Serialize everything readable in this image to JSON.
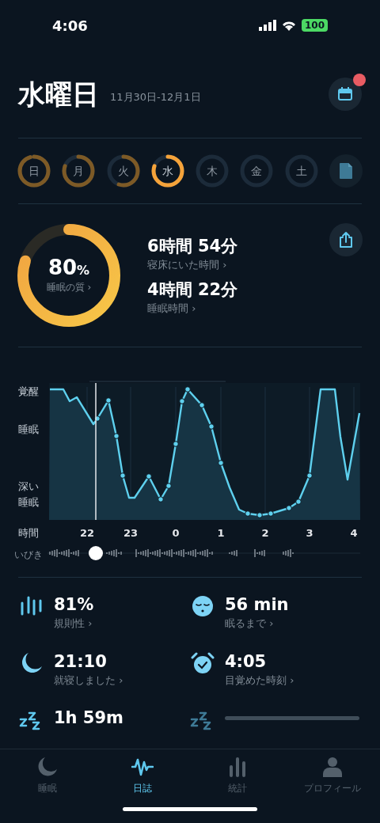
{
  "status_bar": {
    "time": "4:06",
    "battery": "100"
  },
  "header": {
    "title": "水曜日",
    "date_range": "11月30日-12月1日",
    "calendar_badge": true
  },
  "days": [
    {
      "label": "日",
      "selected": false
    },
    {
      "label": "月",
      "selected": false
    },
    {
      "label": "火",
      "selected": false
    },
    {
      "label": "水",
      "selected": true
    },
    {
      "label": "木",
      "selected": false
    },
    {
      "label": "金",
      "selected": false
    },
    {
      "label": "土",
      "selected": false
    }
  ],
  "summary": {
    "quality": {
      "value": "80",
      "unit": "%",
      "label": "睡眠の質 ›"
    },
    "metrics": [
      {
        "value": "6時間 54分",
        "label": "寝床にいた時間 ›"
      },
      {
        "value": "4時間 22分",
        "label": "睡眠時間 ›"
      }
    ]
  },
  "sleep_graph": {
    "y_labels": [
      [
        "覚醒"
      ],
      [
        "睡眠"
      ],
      [
        "深い",
        "睡眠"
      ]
    ],
    "x_axis_label": "時間",
    "x_labels": [
      "22",
      "23",
      "0",
      "1",
      "2",
      "3",
      "4"
    ],
    "snore_label": "いびき"
  },
  "stats": [
    {
      "kind": "bars",
      "value": "81%",
      "label": "規則性 ›"
    },
    {
      "kind": "sleepy-face",
      "value": "56 min",
      "label": "眠るまで ›"
    },
    {
      "kind": "moon",
      "value": "21:10",
      "label": "就寝しました ›"
    },
    {
      "kind": "alarm",
      "value": "4:05",
      "label": "目覚めた時刻 ›"
    },
    {
      "kind": "zzz",
      "value": "1h 59m"
    },
    {
      "kind": "zzz-loading"
    }
  ],
  "tabs": [
    {
      "kind": "moon",
      "label": "睡眠",
      "selected": false
    },
    {
      "kind": "wave",
      "label": "日誌",
      "selected": true
    },
    {
      "kind": "bars",
      "label": "統計",
      "selected": false
    },
    {
      "kind": "person",
      "label": "プロフィール",
      "selected": false
    }
  ]
}
